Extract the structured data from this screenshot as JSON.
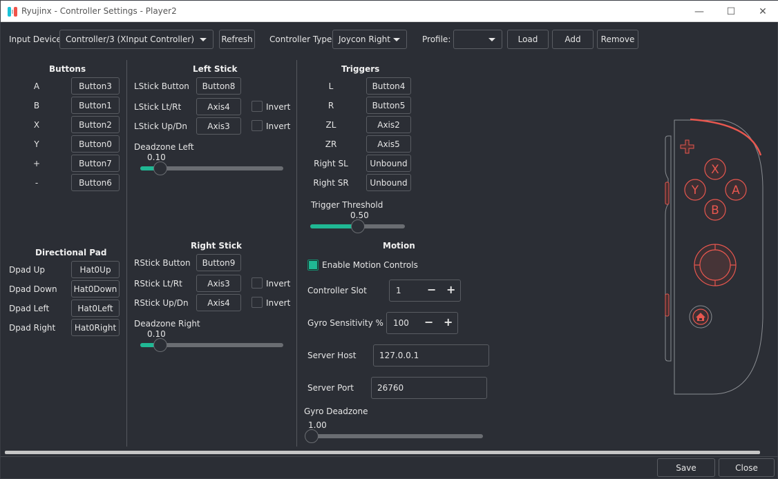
{
  "window": {
    "title": "Ryujinx - Controller Settings - Player2",
    "minimize_glyph": "—",
    "maximize_glyph": "☐",
    "close_glyph": "✕"
  },
  "toolbar": {
    "input_device_label": "Input Device",
    "input_device_value": "Controller/3 (XInput Controller)",
    "refresh_label": "Refresh",
    "controller_type_label": "Controller Type:",
    "controller_type_value": "Joycon Right",
    "profile_label": "Profile:",
    "profile_value": "",
    "load_label": "Load",
    "add_label": "Add",
    "remove_label": "Remove"
  },
  "buttons": {
    "title": "Buttons",
    "rows": [
      {
        "label": "A",
        "value": "Button3"
      },
      {
        "label": "B",
        "value": "Button1"
      },
      {
        "label": "X",
        "value": "Button2"
      },
      {
        "label": "Y",
        "value": "Button0"
      },
      {
        "label": "+",
        "value": "Button7"
      },
      {
        "label": "-",
        "value": "Button6"
      }
    ]
  },
  "dpad": {
    "title": "Directional Pad",
    "rows": [
      {
        "label": "Dpad Up",
        "value": "Hat0Up"
      },
      {
        "label": "Dpad Down",
        "value": "Hat0Down"
      },
      {
        "label": "Dpad Left",
        "value": "Hat0Left"
      },
      {
        "label": "Dpad Right",
        "value": "Hat0Right"
      }
    ]
  },
  "left_stick": {
    "title": "Left Stick",
    "button_label": "LStick Button",
    "button_value": "Button8",
    "ltrt_label": "LStick Lt/Rt",
    "ltrt_value": "Axis4",
    "updn_label": "LStick Up/Dn",
    "updn_value": "Axis3",
    "invert_label": "Invert",
    "deadzone_label": "Deadzone Left",
    "deadzone_value": "0.10",
    "deadzone_fraction": 0.1
  },
  "right_stick": {
    "title": "Right Stick",
    "button_label": "RStick Button",
    "button_value": "Button9",
    "ltrt_label": "RStick Lt/Rt",
    "ltrt_value": "Axis3",
    "updn_label": "RStick Up/Dn",
    "updn_value": "Axis4",
    "invert_label": "Invert",
    "deadzone_label": "Deadzone Right",
    "deadzone_value": "0.10",
    "deadzone_fraction": 0.1
  },
  "triggers": {
    "title": "Triggers",
    "rows": [
      {
        "label": "L",
        "value": "Button4"
      },
      {
        "label": "R",
        "value": "Button5"
      },
      {
        "label": "ZL",
        "value": "Axis2"
      },
      {
        "label": "ZR",
        "value": "Axis5"
      },
      {
        "label": "Right SL",
        "value": "Unbound"
      },
      {
        "label": "Right SR",
        "value": "Unbound"
      }
    ],
    "threshold_label": "Trigger Threshold",
    "threshold_value": "0.50",
    "threshold_fraction": 0.5
  },
  "motion": {
    "title": "Motion",
    "enable_label": "Enable Motion Controls",
    "enable_checked": true,
    "slot_label": "Controller Slot",
    "slot_value": "1",
    "sensitivity_label": "Gyro Sensitivity %",
    "sensitivity_value": "100",
    "host_label": "Server Host",
    "host_value": "127.0.0.1",
    "port_label": "Server Port",
    "port_value": "26760",
    "deadzone_label": "Gyro Deadzone",
    "deadzone_value": "1.00",
    "deadzone_fraction": 0.0,
    "minus_glyph": "−",
    "plus_glyph": "+"
  },
  "joycon": {
    "buttons": [
      "X",
      "Y",
      "A",
      "B"
    ],
    "accent": "#e8574f",
    "outline": "#8a8d92"
  },
  "footer": {
    "save_label": "Save",
    "close_label": "Close"
  },
  "colors": {
    "background": "#2b2e35",
    "accent": "#20b894",
    "border": "#5a5d63"
  }
}
